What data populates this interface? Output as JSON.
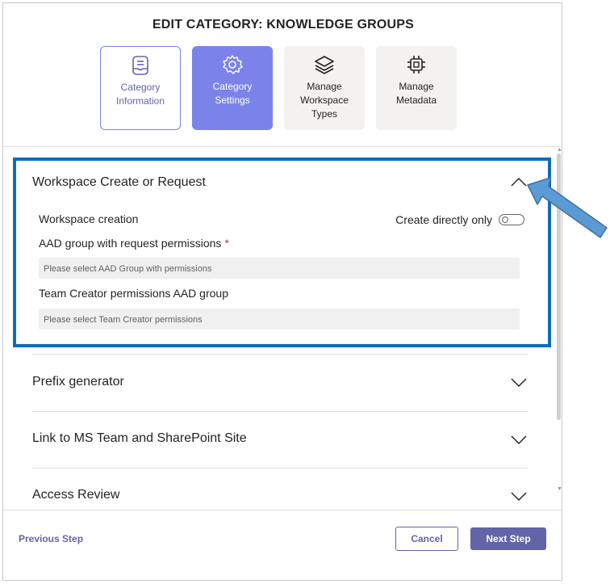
{
  "dialog": {
    "title": "EDIT CATEGORY: KNOWLEDGE GROUPS",
    "steps": [
      {
        "label": "Category Information",
        "icon": "document-list-icon",
        "state": "visited"
      },
      {
        "label": "Category Settings",
        "icon": "gear-icon",
        "state": "active"
      },
      {
        "label": "Manage Workspace Types",
        "icon": "stack-layers-icon",
        "state": "default"
      },
      {
        "label": "Manage Metadata",
        "icon": "chip-icon",
        "state": "default"
      }
    ]
  },
  "sections": {
    "workspace": {
      "title": "Workspace Create or Request",
      "expanded": true,
      "workspace_creation_label": "Workspace creation",
      "toggle_label": "Create directly only",
      "toggle_on": false,
      "aad_label": "AAD group with request permissions",
      "aad_required_mark": "*",
      "aad_placeholder": "Please select AAD Group with permissions",
      "team_creator_label": "Team Creator permissions AAD group",
      "team_creator_placeholder": "Please select Team Creator permissions"
    },
    "prefix": {
      "title": "Prefix generator",
      "expanded": false
    },
    "link": {
      "title": "Link to MS Team and SharePoint Site",
      "expanded": false
    },
    "access": {
      "title": "Access Review",
      "expanded": false
    }
  },
  "footer": {
    "previous_label": "Previous Step",
    "cancel_label": "Cancel",
    "next_label": "Next Step"
  },
  "colors": {
    "accent": "#6264a7",
    "accent_light": "#7b83eb",
    "highlight_box": "#0f6cbd",
    "arrow": "#5b9bd5"
  }
}
